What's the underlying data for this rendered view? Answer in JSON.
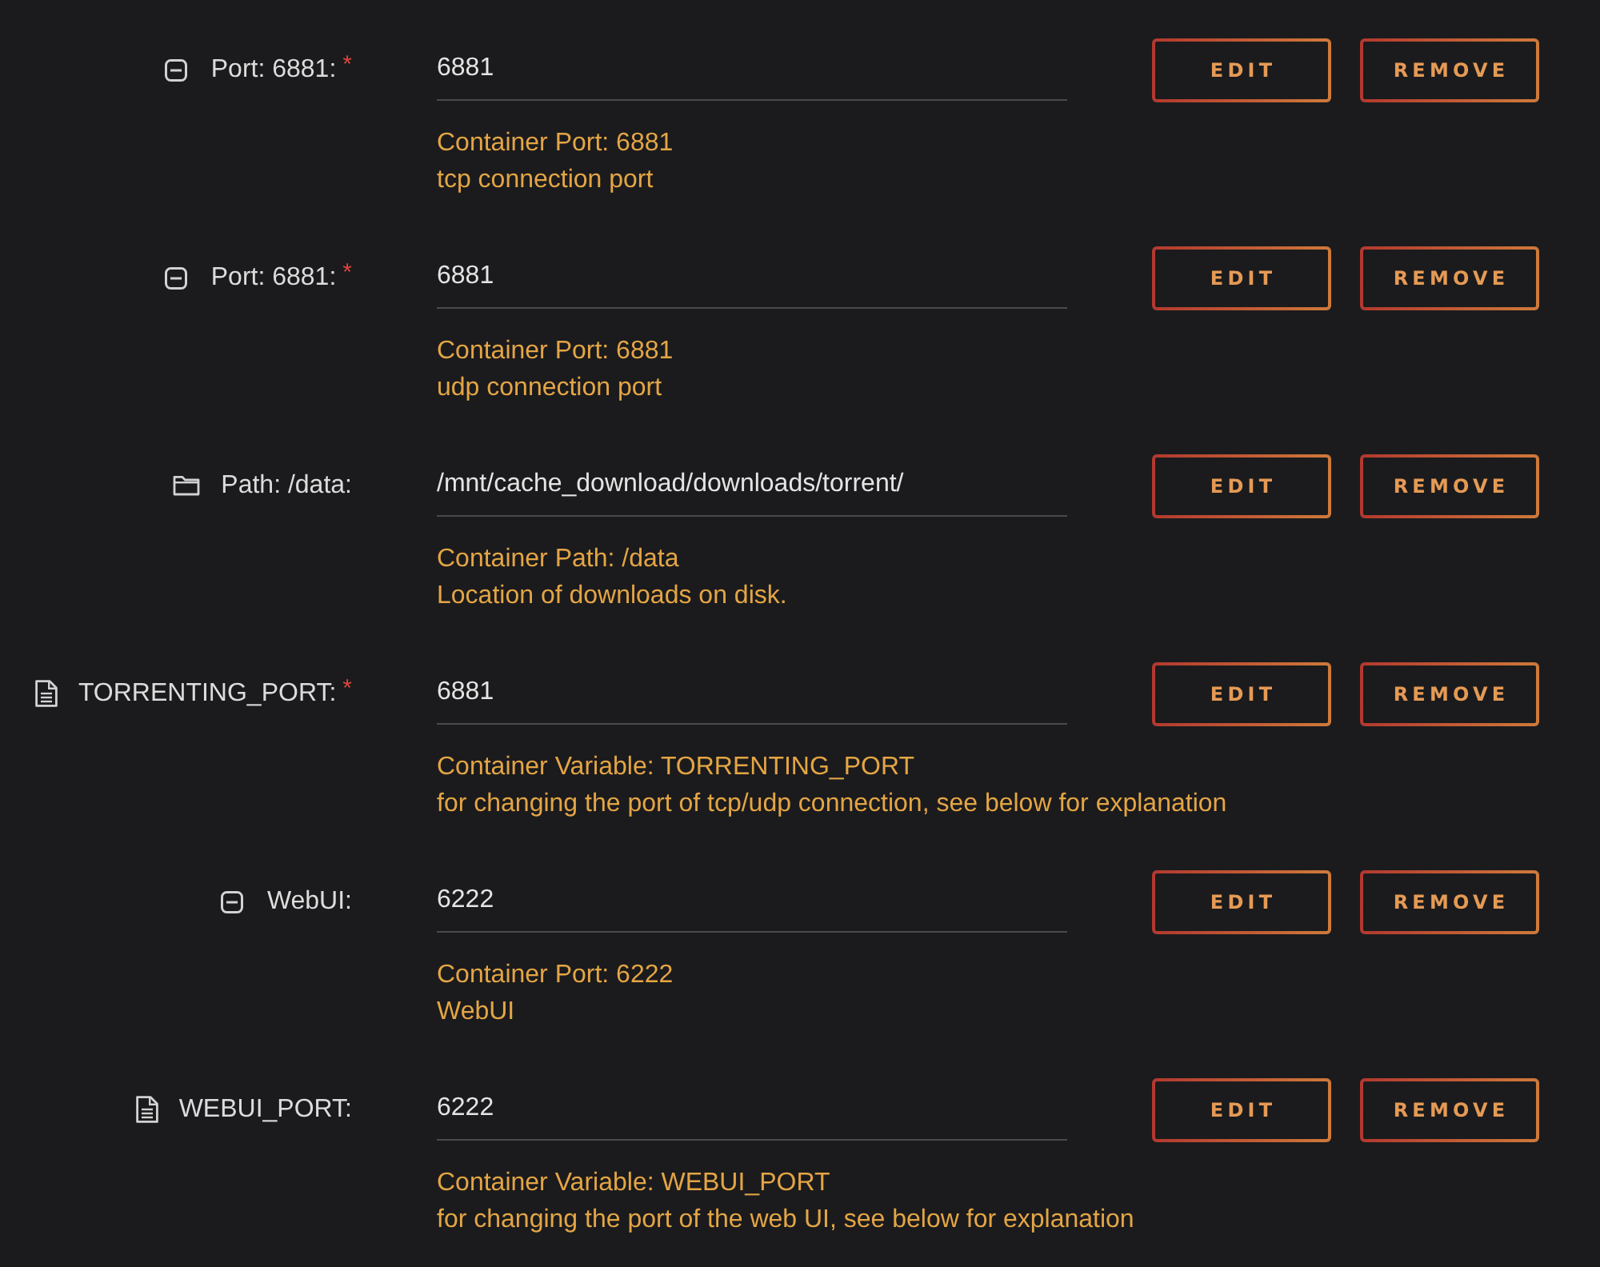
{
  "entries": [
    {
      "kind": "port",
      "label": "Port: 6881:",
      "required_mark": "*",
      "value": "6881",
      "description": [
        "Container Port: 6881",
        "tcp connection port"
      ],
      "actions": [
        "EDIT",
        "REMOVE"
      ]
    },
    {
      "kind": "port",
      "label": "Port: 6881:",
      "required_mark": "*",
      "value": "6881",
      "description": [
        "Container Port: 6881",
        "udp connection port"
      ],
      "actions": [
        "EDIT",
        "REMOVE"
      ]
    },
    {
      "kind": "path",
      "label": "Path: /data:",
      "value": "/mnt/cache_download/downloads/torrent/",
      "description": [
        "Container Path: /data",
        "Location of downloads on disk."
      ],
      "actions": [
        "EDIT",
        "REMOVE"
      ]
    },
    {
      "kind": "variable",
      "label": "TORRENTING_PORT:",
      "required_mark": "*",
      "value": "6881",
      "description": [
        "Container Variable: TORRENTING_PORT",
        "for changing the port of tcp/udp connection, see below for explanation"
      ],
      "actions": [
        "EDIT",
        "REMOVE"
      ]
    },
    {
      "kind": "port",
      "label": "WebUI:",
      "value": "6222",
      "description": [
        "Container Port: 6222",
        "WebUI"
      ],
      "actions": [
        "EDIT",
        "REMOVE"
      ]
    },
    {
      "kind": "variable",
      "label": "WEBUI_PORT:",
      "value": "6222",
      "description": [
        "Container Variable: WEBUI_PORT",
        "for changing the port of the web UI, see below for explanation"
      ],
      "actions": [
        "EDIT",
        "REMOVE"
      ]
    }
  ]
}
